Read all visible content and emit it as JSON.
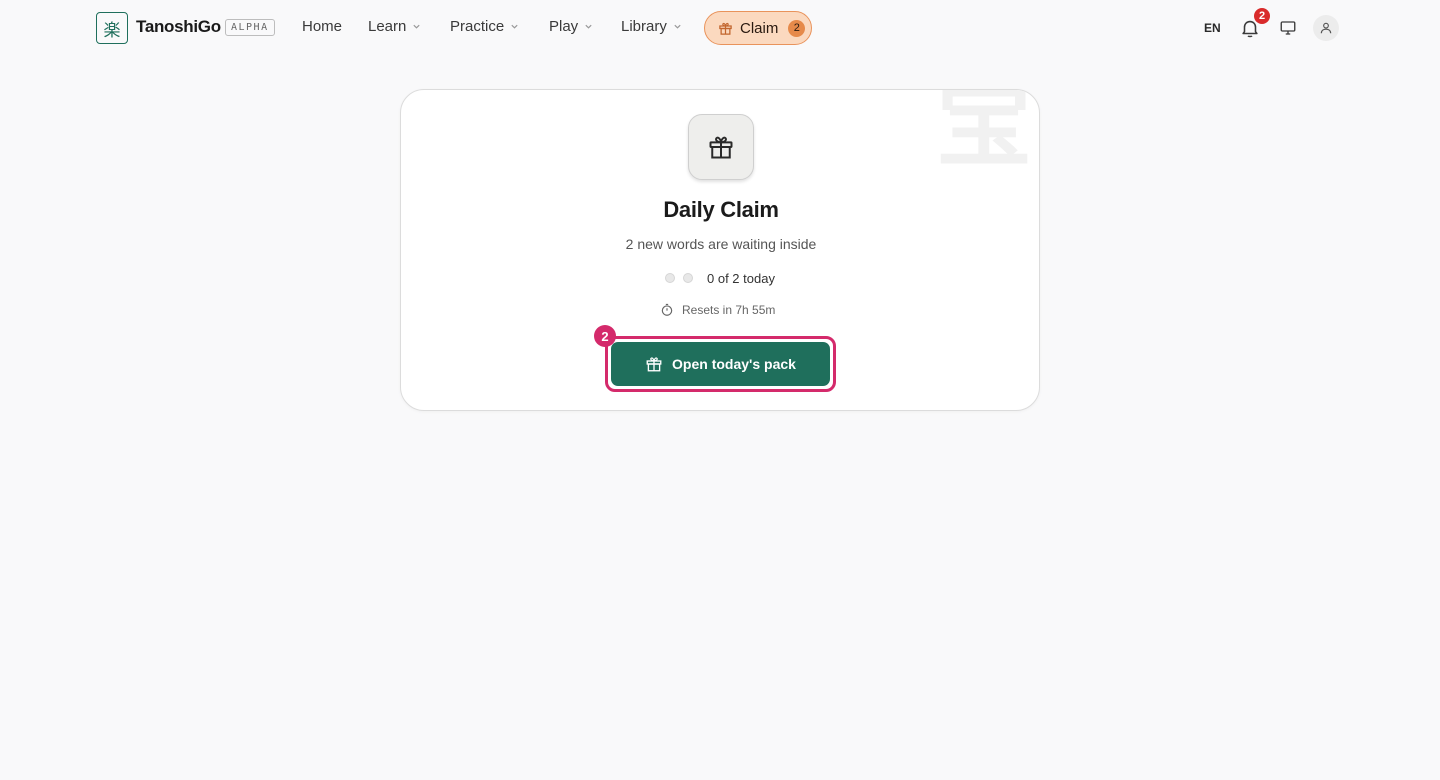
{
  "header": {
    "logo_glyph": "楽",
    "brand": "TanoshiGo",
    "badge": "ALPHA",
    "nav": [
      {
        "label": "Home",
        "has_menu": false
      },
      {
        "label": "Learn",
        "has_menu": true
      },
      {
        "label": "Practice",
        "has_menu": true
      },
      {
        "label": "Play",
        "has_menu": true
      },
      {
        "label": "Library",
        "has_menu": true
      }
    ],
    "claim": {
      "label": "Claim",
      "count": "2"
    },
    "language": "EN",
    "notifications_count": "2"
  },
  "card": {
    "watermark": "宝",
    "title": "Daily Claim",
    "subtitle": "2 new words are waiting inside",
    "progress_text": "0 of 2 today",
    "progress": {
      "claimed": 0,
      "total": 2
    },
    "reset_text": "Resets in 7h 55m",
    "button_label": "Open today's pack",
    "step_badge": "2"
  },
  "colors": {
    "brand_green": "#1f6f5c",
    "claim_fill": "#fbd9bf",
    "claim_border": "#e9935b",
    "notification_red": "#d92b2b",
    "focus_pink": "#d42a6b"
  },
  "icons": [
    "gift-icon",
    "bell-icon",
    "monitor-icon",
    "user-icon",
    "timer-icon",
    "chevron-down-icon"
  ]
}
